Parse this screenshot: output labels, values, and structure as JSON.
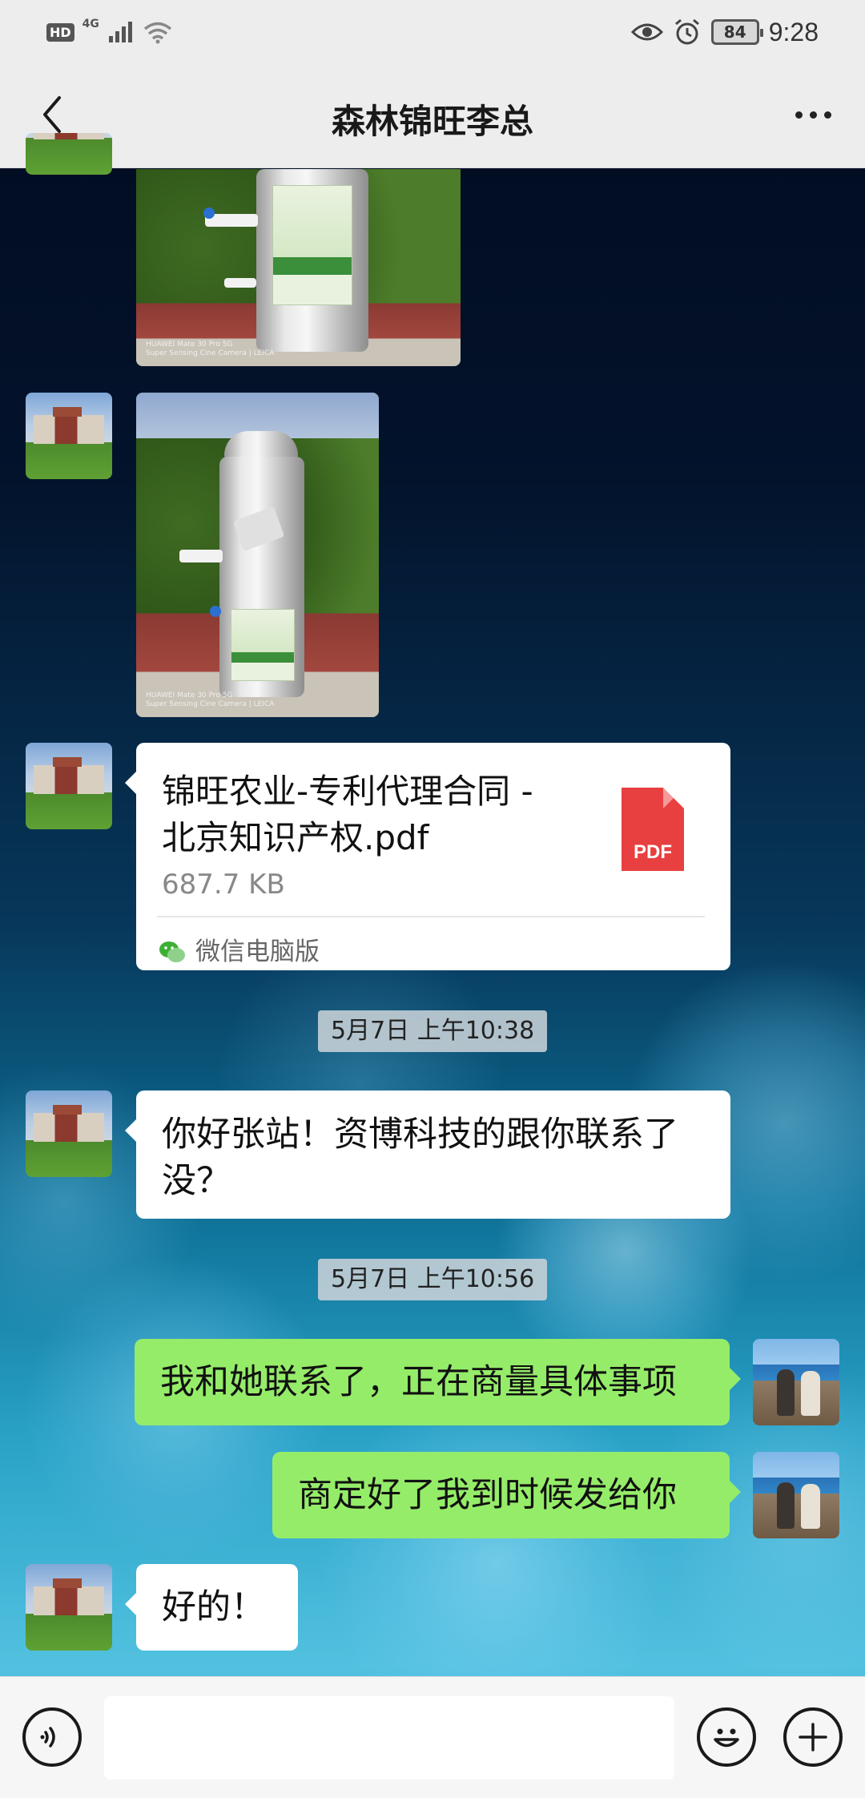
{
  "status_bar": {
    "hd": "HD",
    "network": "4G",
    "battery": "84",
    "time": "9:28"
  },
  "header": {
    "title": "森林锦旺李总"
  },
  "messages": {
    "file": {
      "name_line1": "锦旺农业-专利代理合同 -",
      "name_line2": "北京知识产权.pdf",
      "size": "687.7 KB",
      "type_label": "PDF",
      "source": "微信电脑版"
    },
    "timestamp1": "5月7日 上午10:38",
    "msg1_line1": "你好张站！资博科技的跟你联系了",
    "msg1_line2": "没？",
    "timestamp2": "5月7日 上午10:56",
    "msg2": "我和她联系了，正在商量具体事项",
    "msg3": "商定好了我到时候发给你",
    "msg4": "好的！"
  },
  "photo_watermark": {
    "line1": "HUAWEI Mate 30 Pro 5G",
    "line2": "Super Sensing Cine Camera | LEICA"
  },
  "input_bar": {
    "placeholder": ""
  },
  "icons": {
    "back": "chevron-left-icon",
    "more": "more-dots-icon",
    "voice": "voice-icon",
    "emoji": "emoji-icon",
    "add": "plus-icon",
    "wechat": "wechat-icon",
    "pdf": "pdf-file-icon"
  },
  "colors": {
    "bubble_sent": "#95ec69",
    "bubble_received": "#ffffff",
    "pdf_red": "#e84040",
    "bar_gray": "#ededed"
  }
}
